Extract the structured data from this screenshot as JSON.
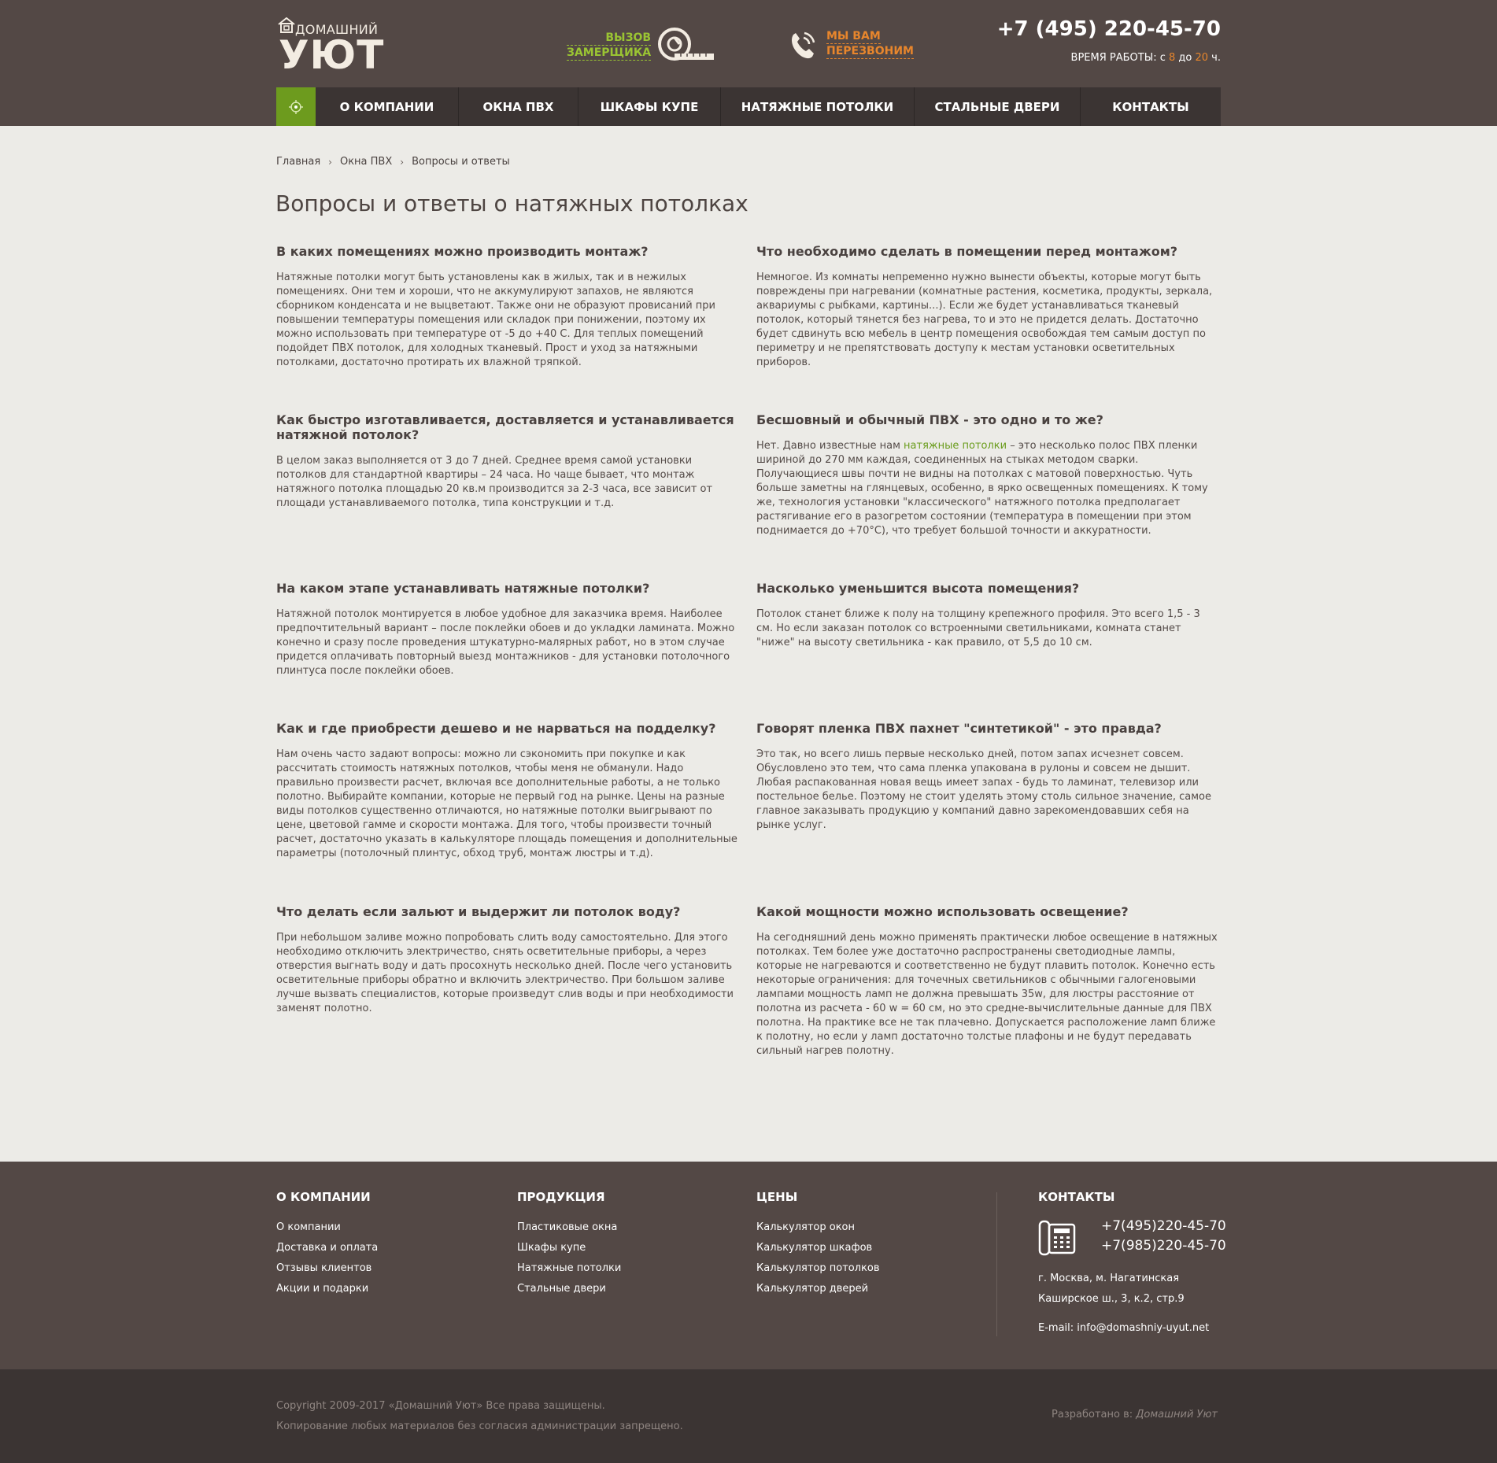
{
  "header": {
    "logo_small": "ДОМАШНИЙ",
    "logo_big": "УЮТ",
    "measure_line1": "ВЫЗОВ",
    "measure_line2": "ЗАМЕРЩИКА",
    "callback_line1": "МЫ ВАМ",
    "callback_line2": "ПЕРЕЗВОНИМ",
    "phone": "+7 (495) 220-45-70",
    "hours_prefix": "ВРЕМЯ РАБОТЫ: с ",
    "hours_from": "8",
    "hours_mid": " до ",
    "hours_to": "20",
    "hours_suffix": " ч.",
    "accent_green": "#6d9b1e",
    "accent_orange": "#e8862c"
  },
  "nav": {
    "items": [
      {
        "label": "О КОМПАНИИ"
      },
      {
        "label": "ОКНА ПВХ"
      },
      {
        "label": "ШКАФЫ КУПЕ"
      },
      {
        "label": "НАТЯЖНЫЕ ПОТОЛКИ"
      },
      {
        "label": "СТАЛЬНЫЕ ДВЕРИ"
      },
      {
        "label": "КОНТАКТЫ"
      }
    ]
  },
  "breadcrumb": [
    "Главная",
    "Окна ПВХ",
    "Вопросы и ответы"
  ],
  "page_title": "Вопросы и ответы о натяжных потолках",
  "qa": [
    {
      "q": "В каких помещениях можно производить монтаж?",
      "a": "Натяжные потолки могут быть установлены как в жилых, так и в нежилых помещениях. Они тем и хороши, что не аккумулируют запахов, не являются сборником конденсата и не выцветают. Также они не образуют провисаний при повышении температуры помещения или складок при понижении, поэтому их можно использовать при температуре от -5 до +40 С. Для теплых помещений подойдет ПВХ потолок, для холодных тканевый. Прост и уход за натяжными потолками, достаточно протирать их влажной тряпкой."
    },
    {
      "q": "Что необходимо сделать в помещении перед монтажом?",
      "a": "Немногое. Из комнаты непременно нужно вынести объекты, которые могут быть повреждены при нагревании (комнатные растения, косметика, продукты, зеркала, аквариумы с рыбками, картины...). Если же будет устанавливаться тканевый потолок, который тянется без нагрева, то и это не придется делать. Достаточно будет сдвинуть всю мебель в центр помещения освобождая тем самым доступ по периметру и не препятствовать доступу к местам установки осветительных приборов."
    },
    {
      "q": "Как быстро изготавливается, доставляется и устанавливается натяжной  потолок?",
      "a": "В целом заказ выполняется от 3 до 7 дней. Среднее время самой установки потолков для стандартной квартиры – 24 часа. Но чаще бывает, что монтаж натяжного потолка площадью 20 кв.м производится за 2-3 часа, все зависит от площади устанавливаемого потолка, типа конструкции и т.д."
    },
    {
      "q": "Бесшовный и обычный ПВХ - это одно и то же?",
      "a_before": "Нет. Давно известные нам ",
      "a_link": "натяжные потолки",
      "a_after": " – это несколько полос ПВХ пленки шириной до 270 мм каждая, соединенных на стыках методом сварки. Получающиеся швы почти не видны на потолках с матовой поверхностью. Чуть больше заметны на глянцевых, особенно, в ярко освещенных помещениях. К тому же, технология установки \"классического\" натяжного потолка предполагает растягивание его в разогретом состоянии (температура в помещении при этом поднимается до +70°С), что требует большой точности и аккуратности."
    },
    {
      "q": "На каком этапе устанавливать натяжные потолки?",
      "a": "Натяжной потолок монтируется в любое удобное для заказчика время. Наиболее предпочтительный вариант – после поклейки обоев и до укладки ламината. Можно конечно и сразу после проведения штукатурно-малярных работ, но в этом случае придется оплачивать повторный выезд монтажников - для установки потолочного плинтуса после поклейки обоев."
    },
    {
      "q": "Насколько уменьшится высота помещения?",
      "a": "Потолок станет ближе к полу на толщину крепежного профиля. Это всего 1,5 - 3 см. Но если заказан потолок со встроенными светильниками, комната станет \"ниже\" на высоту светильника - как правило, от 5,5 до 10 см."
    },
    {
      "q": "Как и где приобрести дешево и не нарваться на подделку?",
      "a": "Нам очень часто задают вопросы: можно ли сэкономить при покупке и как рассчитать стоимость натяжных потолков, чтобы меня не обманули. Надо правильно произвести расчет, включая все дополнительные работы, а не только полотно. Выбирайте компании, которые не первый год на рынке. Цены на разные виды потолков существенно отличаются, но натяжные потолки выигрывают по цене, цветовой гамме и скорости монтажа. Для того, чтобы произвести точный расчет, достаточно указать в калькуляторе площадь помещения и дополнительные параметры (потолочный плинтус, обход труб, монтаж люстры и т.д)."
    },
    {
      "q": "Говорят пленка ПВХ пахнет \"синтетикой\" - это правда?",
      "a": "Это так, но всего лишь первые несколько дней, потом запах исчезнет совсем. Обусловлено это тем, что сама пленка упакована в рулоны и совсем не дышит. Любая распакованная новая вещь имеет запах - будь то ламинат, телевизор или постельное белье. Поэтому не стоит уделять этому столь сильное значение, самое главное заказывать продукцию у компаний давно зарекомендовавших себя на рынке услуг."
    },
    {
      "q": "Что делать если зальют и выдержит ли потолок воду?",
      "a": "При небольшом заливе можно попробовать слить воду самостоятельно. Для этого необходимо отключить электричество, снять осветительные приборы, а через отверстия выгнать воду и дать просохнуть несколько дней. После чего установить осветительные приборы обратно и включить электричество. При большом заливе лучше вызвать специалистов, которые произведут слив воды и при необходимости заменят полотно."
    },
    {
      "q": "Какой мощности можно использовать освещение?",
      "a": "На сегодняшний день можно применять практически любое освещение в натяжных потолках. Тем более уже достаточно распространены светодиодные лампы, которые не нагреваются и соответственно не будут плавить потолок. Конечно есть некоторые ограничения: для точечных светильников с обычными галогеновыми лампами мощность ламп не должна превышать 35w, для люстры расстояние от полотна из расчета - 60 w = 60 см, но это средне-вычислительные данные для ПВХ полотна. На практике все не так плачевно. Допускается расположение ламп ближе к полотну, но если у ламп достаточно толстые плафоны и не будут передавать сильный нагрев полотну."
    }
  ],
  "footer": {
    "col1_title": "О КОМПАНИИ",
    "col1_items": [
      "О компании",
      "Доставка и оплата",
      "Отзывы клиентов",
      "Акции и подарки"
    ],
    "col2_title": "ПРОДУКЦИЯ",
    "col2_items": [
      "Пластиковые окна",
      "Шкафы купе",
      "Натяжные потолки",
      "Стальные двери"
    ],
    "col3_title": "ЦЕНЫ",
    "col3_items": [
      "Калькулятор окон",
      "Калькулятор шкафов",
      "Калькулятор потолков",
      "Калькулятор дверей"
    ],
    "contacts_title": "КОНТАКТЫ",
    "phone1": "+7(495)220-45-70",
    "phone2": "+7(985)220-45-70",
    "addr1": "г. Москва, м. Нагатинская",
    "addr2": "Каширское ш., 3, к.2, стр.9",
    "email": "E-mail: info@domashniy-uyut.net"
  },
  "bottom": {
    "copyright": "Copyright 2009-2017 «Домашний Уют» Все права защищены.",
    "notice": "Копирование любых материалов без согласия администрации запрещено.",
    "dev_prefix": "Разработано в: ",
    "dev_name": "Домашний Уют"
  }
}
